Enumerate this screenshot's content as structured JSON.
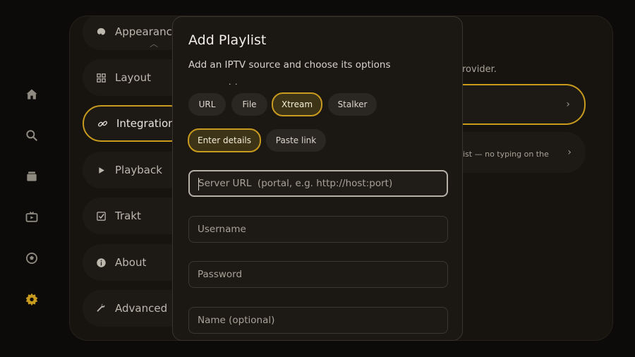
{
  "rail": {
    "icons": [
      "home-icon",
      "search-icon",
      "library-icon",
      "tv-icon",
      "sports-icon",
      "settings-icon"
    ]
  },
  "settings": {
    "categories": [
      {
        "label": "Appearance",
        "icon": "palette-icon"
      },
      {
        "label": "Layout",
        "icon": "grid-icon"
      },
      {
        "label": "Integrations",
        "icon": "link-icon"
      },
      {
        "label": "Playback",
        "icon": "play-icon"
      },
      {
        "label": "Trakt",
        "icon": "check-square-icon"
      },
      {
        "label": "About",
        "icon": "info-icon"
      },
      {
        "label": "Advanced",
        "icon": "wrench-icon"
      }
    ],
    "subtext_fragment": "rovider.",
    "card_text_fragment": "ist — no typing on the"
  },
  "modal": {
    "title": "Add Playlist",
    "subtitle": "Add an IPTV source and choose its options",
    "dots": ". .",
    "source_types": [
      {
        "label": "URL",
        "selected": false
      },
      {
        "label": "File",
        "selected": false
      },
      {
        "label": "Xtream",
        "selected": true
      },
      {
        "label": "Stalker",
        "selected": false
      }
    ],
    "entry_modes": [
      {
        "label": "Enter details",
        "selected": true
      },
      {
        "label": "Paste link",
        "selected": false
      }
    ],
    "fields": {
      "server_url": {
        "placeholder": "Server URL  (portal, e.g. http://host:port)",
        "value": ""
      },
      "username": {
        "placeholder": "Username",
        "value": ""
      },
      "password": {
        "placeholder": "Password",
        "value": ""
      },
      "name": {
        "placeholder": "Name (optional)",
        "value": ""
      }
    }
  },
  "colors": {
    "accent": "#c89a1e",
    "background": "#0c0b09",
    "panel": "#17140f",
    "modal": "#1b1814"
  }
}
